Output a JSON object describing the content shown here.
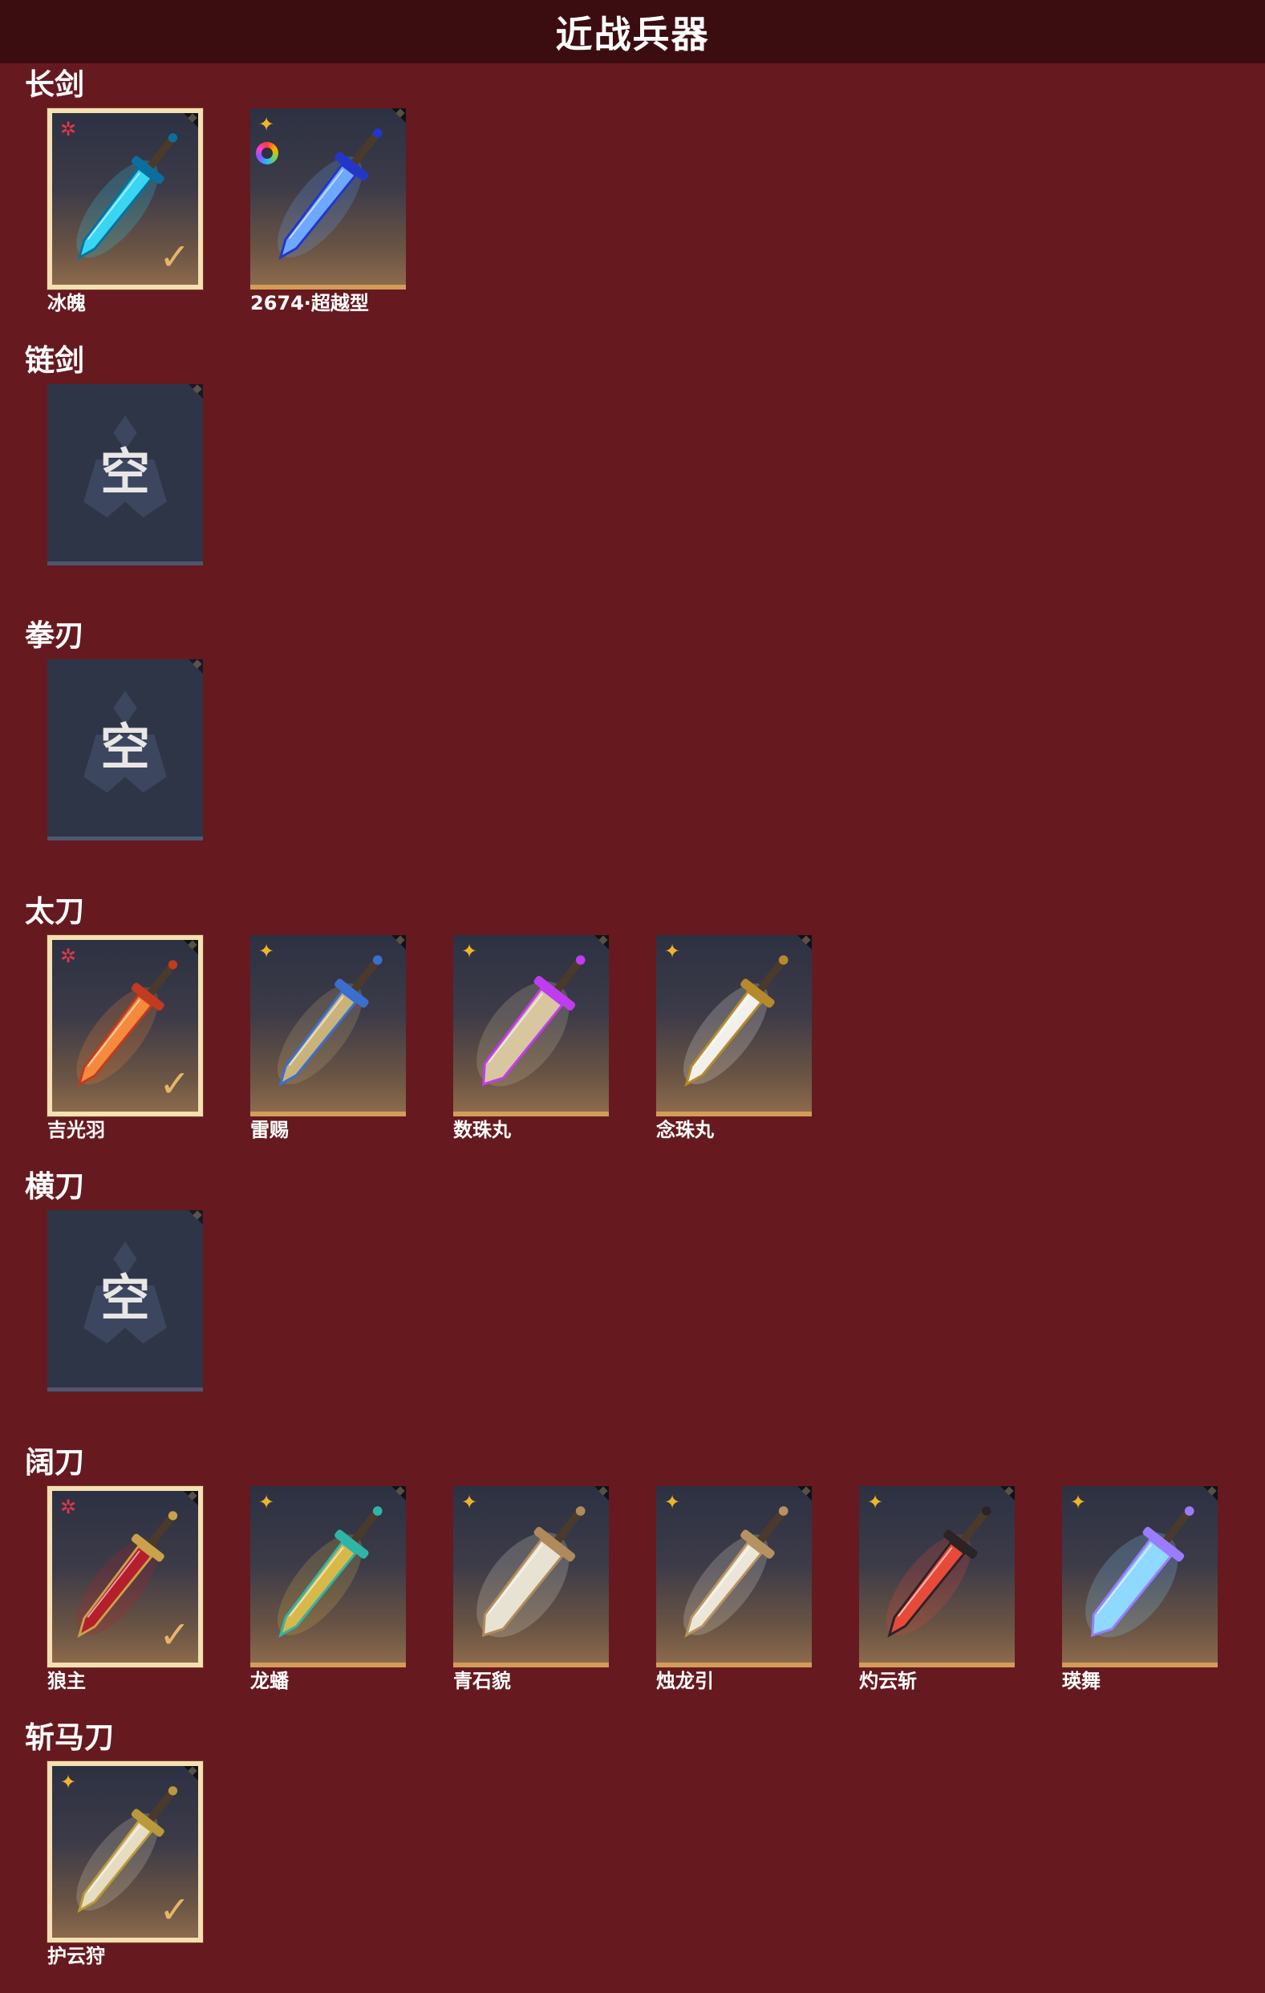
{
  "header": {
    "title": "近战兵器"
  },
  "categories": [
    {
      "title": "长剑",
      "items": [
        {
          "name": "冰魄",
          "rarity": "red",
          "equipped": true,
          "weapon": "ice-sword",
          "colors": [
            "#38d6f2",
            "#0a6fa0"
          ]
        },
        {
          "name": "2674·超越型",
          "rarity": "gold",
          "equipped": false,
          "weapon": "blue-energy-sword",
          "colors": [
            "#6fa8ff",
            "#2336c8"
          ],
          "dye_icon": "color-wheel-icon"
        }
      ]
    },
    {
      "title": "链剑",
      "items": [
        {
          "empty": true,
          "name": "空"
        }
      ]
    },
    {
      "title": "拳刃",
      "items": [
        {
          "empty": true,
          "name": "空"
        }
      ]
    },
    {
      "title": "太刀",
      "items": [
        {
          "name": "吉光羽",
          "rarity": "red",
          "equipped": true,
          "weapon": "fire-katana",
          "colors": [
            "#f58a3c",
            "#c23a1f"
          ]
        },
        {
          "name": "雷赐",
          "rarity": "gold",
          "equipped": false,
          "weapon": "thunder-katana",
          "colors": [
            "#c9b37a",
            "#3a6fd0"
          ]
        },
        {
          "name": "数珠丸",
          "rarity": "gold",
          "equipped": false,
          "weapon": "purple-katana",
          "colors": [
            "#d8c6a0",
            "#c03cf0"
          ]
        },
        {
          "name": "念珠丸",
          "rarity": "gold",
          "equipped": false,
          "weapon": "white-katana",
          "colors": [
            "#f2f0ea",
            "#b68a2a"
          ]
        }
      ]
    },
    {
      "title": "横刀",
      "items": [
        {
          "empty": true,
          "name": "空"
        }
      ]
    },
    {
      "title": "阔刀",
      "items": [
        {
          "name": "狼主",
          "rarity": "red",
          "equipped": true,
          "weapon": "wolf-broadsword",
          "colors": [
            "#b51f2b",
            "#c9a24a"
          ]
        },
        {
          "name": "龙蟠",
          "rarity": "gold",
          "equipped": false,
          "weapon": "dragon-broadsword",
          "colors": [
            "#d9b84a",
            "#2fb5a8"
          ]
        },
        {
          "name": "青石貌",
          "rarity": "gold",
          "equipped": false,
          "weapon": "stone-broadsword",
          "colors": [
            "#e8e2d2",
            "#b08a5a"
          ]
        },
        {
          "name": "烛龙引",
          "rarity": "gold",
          "equipped": false,
          "weapon": "candle-dragon-broadsword",
          "colors": [
            "#ece6d8",
            "#b69262"
          ]
        },
        {
          "name": "灼云斩",
          "rarity": "gold",
          "equipped": false,
          "weapon": "flame-broadsword",
          "colors": [
            "#e84a3a",
            "#2b2326"
          ]
        },
        {
          "name": "瑛舞",
          "rarity": "gold",
          "equipped": false,
          "weapon": "crystal-broadsword",
          "colors": [
            "#8fd8ff",
            "#9a7cff"
          ]
        }
      ]
    },
    {
      "title": "斩马刀",
      "items": [
        {
          "name": "护云狩",
          "rarity": "gold",
          "equipped": true,
          "weapon": "horse-slayer-blade",
          "colors": [
            "#e6dcc0",
            "#b99a3a"
          ]
        }
      ]
    }
  ]
}
